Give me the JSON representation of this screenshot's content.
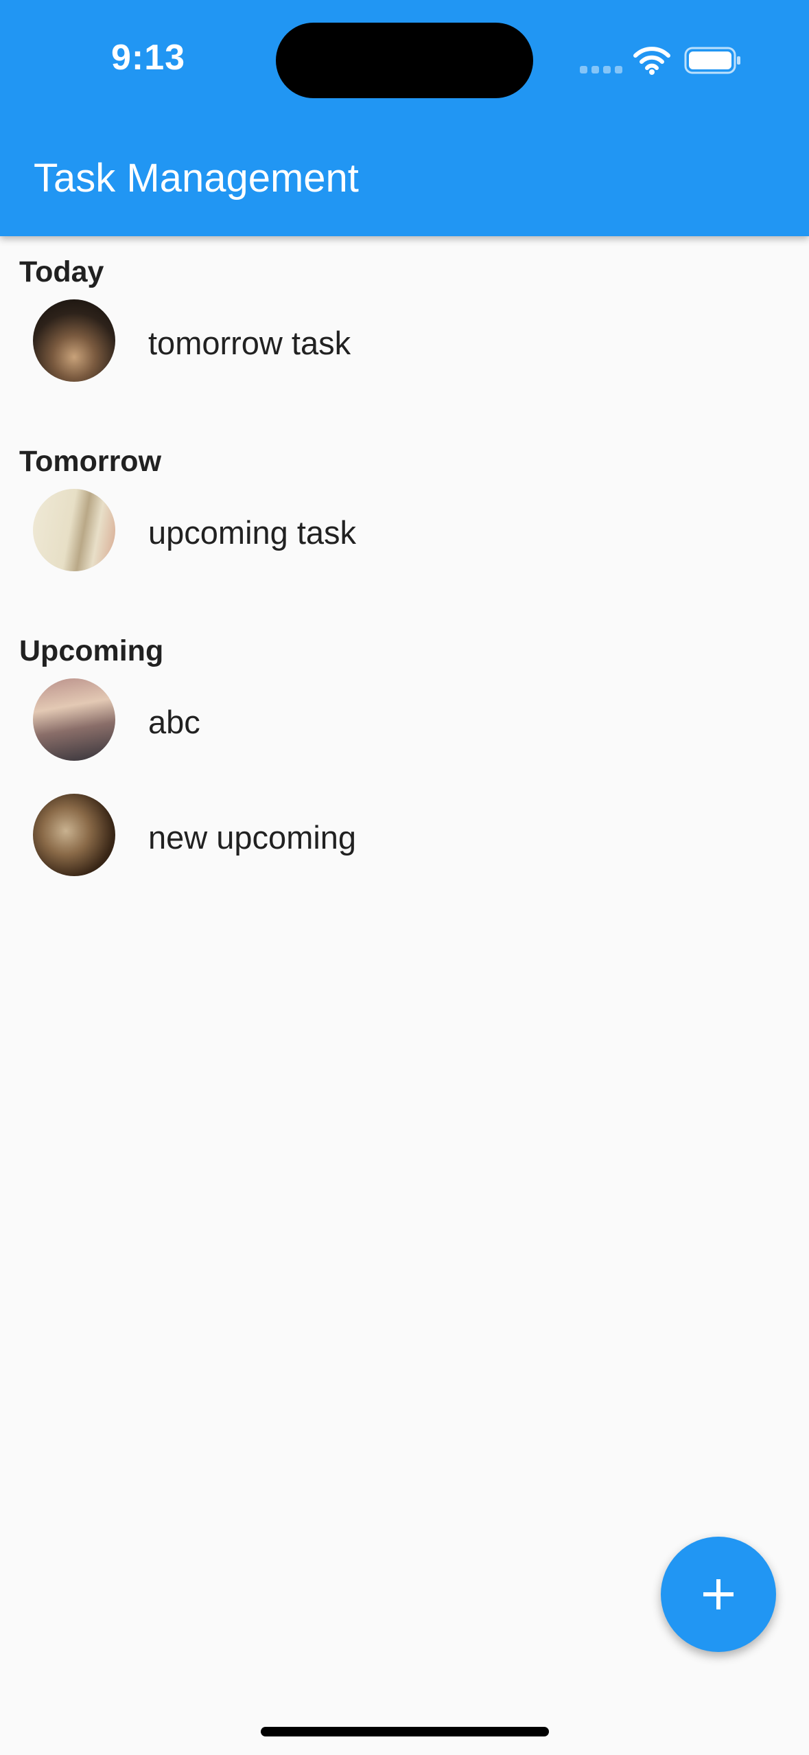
{
  "status_bar": {
    "time": "9:13",
    "icons": [
      "signal-icon",
      "wifi-icon",
      "battery-icon"
    ]
  },
  "app_bar": {
    "title": "Task Management",
    "color": "#2196f3"
  },
  "sections": [
    {
      "header": "Today",
      "tasks": [
        {
          "title": "tomorrow task",
          "avatar": "photo-avatar"
        }
      ]
    },
    {
      "header": "Tomorrow",
      "tasks": [
        {
          "title": "upcoming task",
          "avatar": "photo-avatar"
        }
      ]
    },
    {
      "header": "Upcoming",
      "tasks": [
        {
          "title": "abc",
          "avatar": "photo-avatar"
        },
        {
          "title": "new upcoming",
          "avatar": "photo-avatar"
        }
      ]
    }
  ],
  "fab": {
    "icon": "plus-icon",
    "color": "#2196f3"
  }
}
